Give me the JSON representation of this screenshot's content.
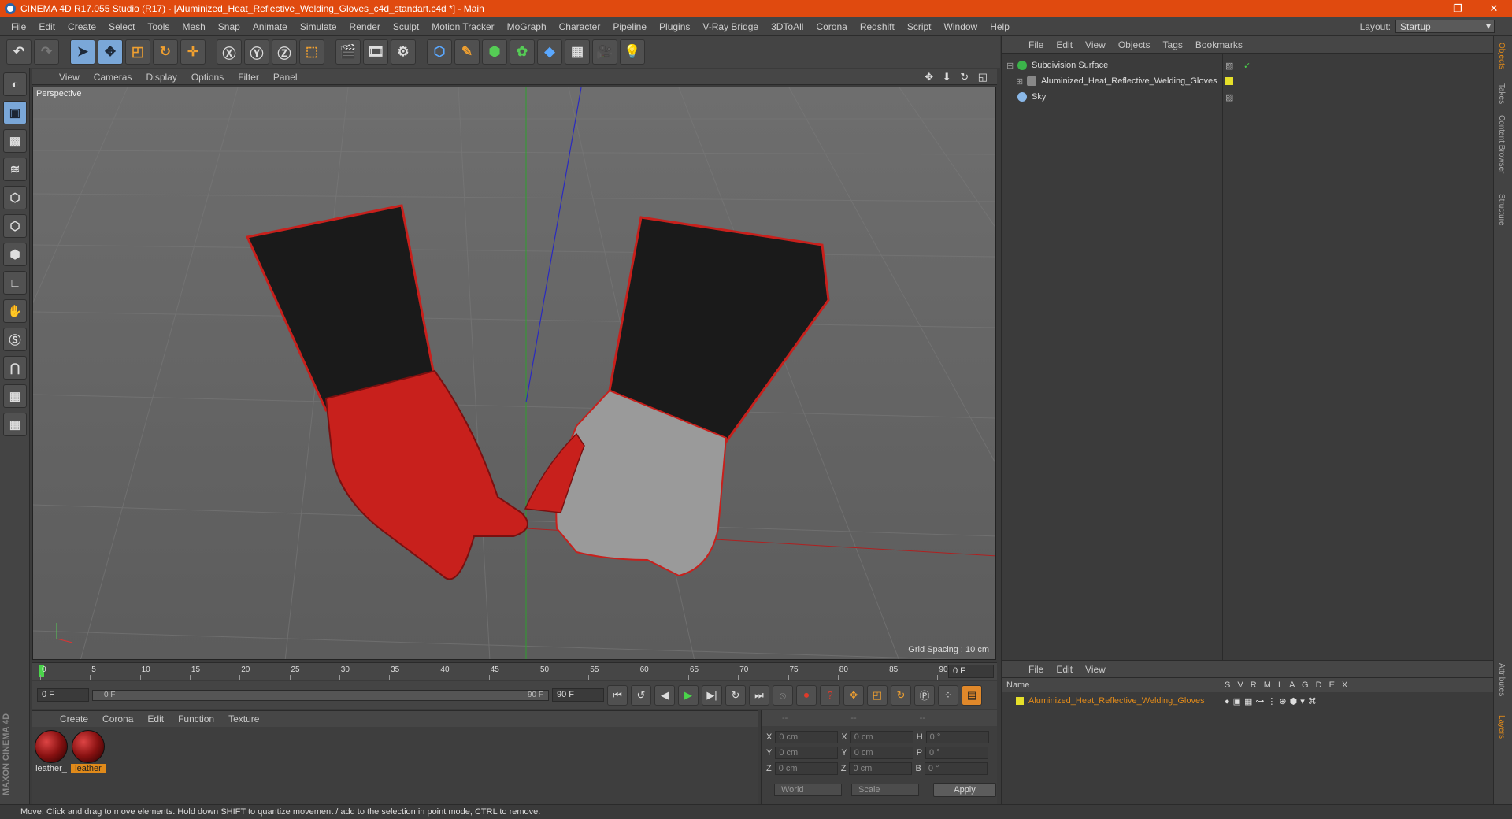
{
  "window": {
    "title": "CINEMA 4D R17.055 Studio (R17) - [Aluminized_Heat_Reflective_Welding_Gloves_c4d_standart.c4d *] - Main",
    "controls": [
      "–",
      "❐",
      "✕"
    ]
  },
  "menubar": [
    "File",
    "Edit",
    "Create",
    "Select",
    "Tools",
    "Mesh",
    "Snap",
    "Animate",
    "Simulate",
    "Render",
    "Sculpt",
    "Motion Tracker",
    "MoGraph",
    "Character",
    "Pipeline",
    "Plugins",
    "V-Ray Bridge",
    "3DToAll",
    "Corona",
    "Redshift",
    "Script",
    "Window",
    "Help"
  ],
  "layout": {
    "label": "Layout:",
    "value": "Startup"
  },
  "viewport": {
    "menu": [
      "View",
      "Cameras",
      "Display",
      "Options",
      "Filter",
      "Panel"
    ],
    "label": "Perspective",
    "grid_spacing": "Grid Spacing : 10 cm",
    "nav_icons": "✥ ⬇ ↻ ◱"
  },
  "timeline": {
    "ticks": [
      "0",
      "5",
      "10",
      "15",
      "20",
      "25",
      "30",
      "35",
      "40",
      "45",
      "50",
      "55",
      "60",
      "65",
      "70",
      "75",
      "80",
      "85",
      "90"
    ],
    "end_field": "0 F",
    "current": "0 F",
    "slider_start": "0 F",
    "slider_end": "90 F",
    "max": "90 F"
  },
  "materials": {
    "menu": [
      "Create",
      "Corona",
      "Edit",
      "Function",
      "Texture"
    ],
    "items": [
      {
        "label": "leather_"
      },
      {
        "label": "leather"
      }
    ]
  },
  "coords": {
    "headers": [
      "--",
      "--",
      "--"
    ],
    "rows": [
      {
        "a": "X",
        "av": "0 cm",
        "b": "X",
        "bv": "0 cm",
        "c": "H",
        "cv": "0 °"
      },
      {
        "a": "Y",
        "av": "0 cm",
        "b": "Y",
        "bv": "0 cm",
        "c": "P",
        "cv": "0 °"
      },
      {
        "a": "Z",
        "av": "0 cm",
        "b": "Z",
        "bv": "0 cm",
        "c": "B",
        "cv": "0 °"
      }
    ],
    "world": "World",
    "scale": "Scale",
    "apply": "Apply"
  },
  "objects": {
    "menu": [
      "File",
      "Edit",
      "View",
      "Objects",
      "Tags",
      "Bookmarks"
    ],
    "items": [
      {
        "name": "Subdivision Surface"
      },
      {
        "name": "Aluminized_Heat_Reflective_Welding_Gloves"
      },
      {
        "name": "Sky"
      }
    ]
  },
  "layers": {
    "menu": [
      "File",
      "Edit",
      "View"
    ],
    "name_header": "Name",
    "col_headers": "S V R M L A G D E X",
    "item": "Aluminized_Heat_Reflective_Welding_Gloves"
  },
  "side_tabs": [
    "Objects",
    "Takes",
    "Content Browser",
    "Structure"
  ],
  "side_tabs_bottom": [
    "Attributes",
    "Layers"
  ],
  "brand": "MAXON CINEMA 4D",
  "status": "Move: Click and drag to move elements. Hold down SHIFT to quantize movement / add to the selection in point mode, CTRL to remove.",
  "colors": {
    "title_bar": "#e04a0f",
    "selection": "#e08a1a",
    "glove_red": "#c8201c"
  }
}
